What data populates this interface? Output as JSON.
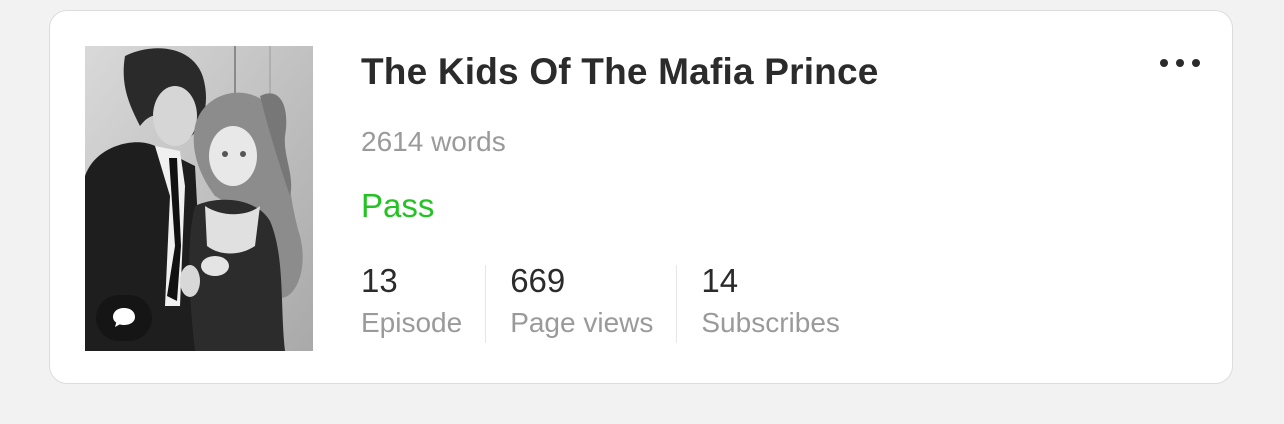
{
  "book": {
    "title": "The Kids Of The Mafia Prince",
    "words": "2614 words",
    "status": "Pass",
    "status_color": "#22c322",
    "cover_icon": "chat-bubble-icon"
  },
  "stats": [
    {
      "value": "13",
      "label": "Episode"
    },
    {
      "value": "669",
      "label": "Page views"
    },
    {
      "value": "14",
      "label": "Subscribes"
    }
  ],
  "menu": {
    "icon": "more-horizontal-icon"
  }
}
